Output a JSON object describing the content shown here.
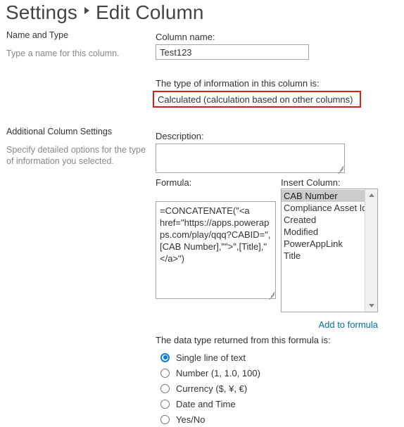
{
  "header": {
    "breadcrumb_root": "Settings",
    "separator_icon": "triangle-right-icon",
    "page_title": "Edit Column"
  },
  "sections": [
    {
      "title": "Name and Type",
      "description": "Type a name for this column."
    },
    {
      "title": "Additional Column Settings",
      "description": "Specify detailed options for the type of information you selected."
    }
  ],
  "form": {
    "column_name": {
      "label": "Column name:",
      "value": "Test123",
      "placeholder": ""
    },
    "type_of_information": {
      "label": "The type of information in this column is:",
      "value": "Calculated (calculation based on other columns)",
      "highlight_color": "#e01b1b"
    },
    "description": {
      "label": "Description:",
      "value": "",
      "placeholder": ""
    },
    "formula": {
      "label": "Formula:",
      "value": "=CONCATENATE(\"<a href=\"https://apps.powerapps.com/play/qqq?CABID=\",[CAB Number],\"\">\",[Title],\"</a>\")",
      "placeholder": ""
    },
    "insert_column": {
      "label": "Insert Column:",
      "options": [
        "CAB Number",
        "Compliance Asset Id",
        "Created",
        "Modified",
        "PowerAppLink",
        "Title"
      ],
      "selected": "CAB Number",
      "scroll_up_icon": "triangle-up-icon",
      "scroll_down_icon": "triangle-down-icon"
    },
    "add_to_formula_link": {
      "label": "Add to formula",
      "color": "#0072a0"
    },
    "data_type": {
      "label": "The data type returned from this formula is:",
      "options": [
        "Single line of text",
        "Number (1, 1.0, 100)",
        "Currency ($, ¥, €)",
        "Date and Time",
        "Yes/No"
      ],
      "selected": "Single line of text",
      "accent_color": "#0078d7"
    }
  }
}
